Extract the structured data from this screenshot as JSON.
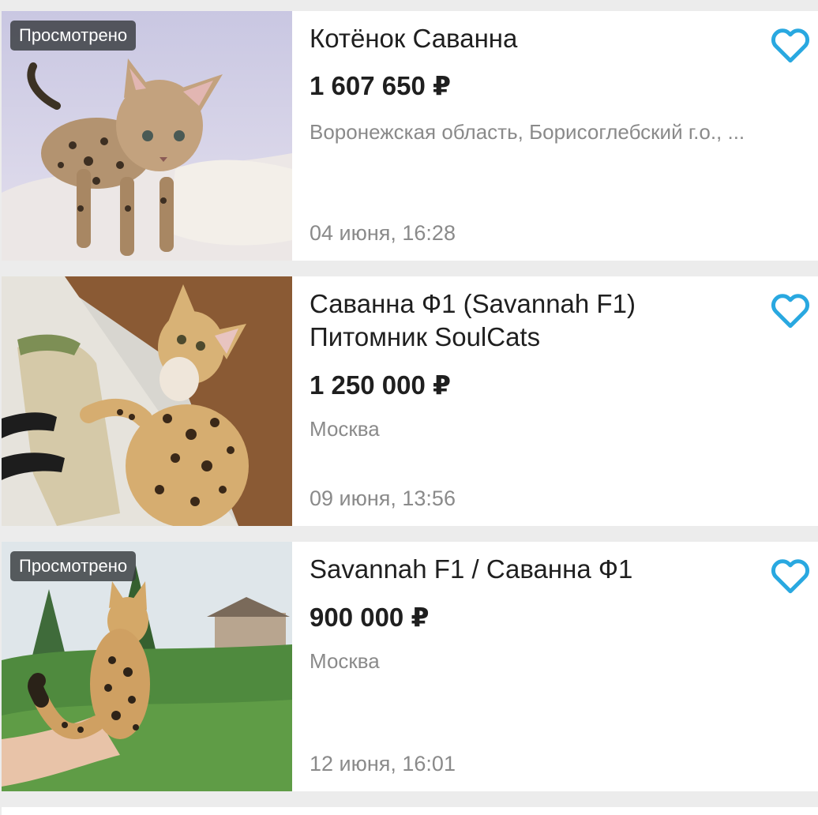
{
  "theme": {
    "accent": "#29a8e0",
    "badge_bg": "#373a3e",
    "text": "#1f1f1f",
    "muted": "#8a8a8a"
  },
  "listings": [
    {
      "viewed_label": "Просмотрено",
      "title": "Котёнок Саванна",
      "price": "1 607 650 ₽",
      "location": "Воронежская область, Борисоглебский г.о., ...",
      "date": "04 июня, 16:28",
      "favorite_icon": "heart-outline-icon"
    },
    {
      "title": "Саванна Ф1 (Savannah F1)\nПитомник SoulCats",
      "price": "1 250 000 ₽",
      "location": "Москва",
      "date": "09 июня, 13:56",
      "favorite_icon": "heart-outline-icon"
    },
    {
      "viewed_label": "Просмотрено",
      "title": "Savannah F1 / Саванна Ф1",
      "price": "900 000 ₽",
      "location": "Москва",
      "date": "12 июня, 16:01",
      "favorite_icon": "heart-outline-icon"
    }
  ]
}
